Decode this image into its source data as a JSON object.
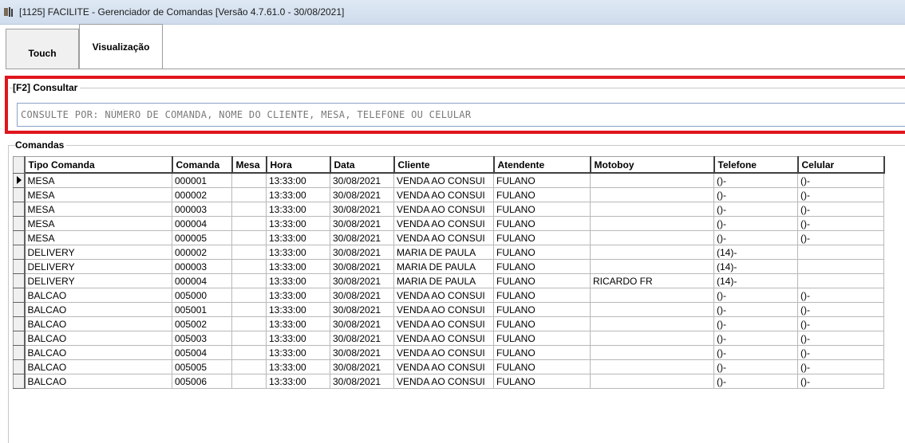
{
  "window": {
    "title": "[1125] FACILITE - Gerenciador de Comandas [Versão 4.7.61.0 - 30/08/2021]"
  },
  "tabs": [
    {
      "label": "Touch"
    },
    {
      "label": "Visualização"
    }
  ],
  "consult": {
    "legend": "[F2] Consultar",
    "placeholder": "CONSULTE POR: NÚMERO DE COMANDA, NOME DO CLIENTE, MESA, TELEFONE OU CELULAR"
  },
  "grid": {
    "legend": "Comandas",
    "columns": [
      "Tipo Comanda",
      "Comanda",
      "Mesa",
      "Hora",
      "Data",
      "Cliente",
      "Atendente",
      "Motoboy",
      "Telefone",
      "Celular"
    ],
    "rows": [
      [
        "MESA",
        "000001",
        "",
        "13:33:00",
        "30/08/2021",
        "VENDA AO CONSUI",
        "FULANO",
        "",
        "()-",
        "()-"
      ],
      [
        "MESA",
        "000002",
        "",
        "13:33:00",
        "30/08/2021",
        "VENDA AO CONSUI",
        "FULANO",
        "",
        "()-",
        "()-"
      ],
      [
        "MESA",
        "000003",
        "",
        "13:33:00",
        "30/08/2021",
        "VENDA AO CONSUI",
        "FULANO",
        "",
        "()-",
        "()-"
      ],
      [
        "MESA",
        "000004",
        "",
        "13:33:00",
        "30/08/2021",
        "VENDA AO CONSUI",
        "FULANO",
        "",
        "()-",
        "()-"
      ],
      [
        "MESA",
        "000005",
        "",
        "13:33:00",
        "30/08/2021",
        "VENDA AO CONSUI",
        "FULANO",
        "",
        "()-",
        "()-"
      ],
      [
        "DELIVERY",
        "000002",
        "",
        "13:33:00",
        "30/08/2021",
        "MARIA DE PAULA",
        "FULANO",
        "",
        "(14)-",
        ""
      ],
      [
        "DELIVERY",
        "000003",
        "",
        "13:33:00",
        "30/08/2021",
        "MARIA DE PAULA",
        "FULANO",
        "",
        "(14)-",
        ""
      ],
      [
        "DELIVERY",
        "000004",
        "",
        "13:33:00",
        "30/08/2021",
        "MARIA DE PAULA",
        "FULANO",
        "RICARDO FR",
        "(14)-",
        ""
      ],
      [
        "BALCAO",
        "005000",
        "",
        "13:33:00",
        "30/08/2021",
        "VENDA AO CONSUI",
        "FULANO",
        "",
        "()-",
        "()-"
      ],
      [
        "BALCAO",
        "005001",
        "",
        "13:33:00",
        "30/08/2021",
        "VENDA AO CONSUI",
        "FULANO",
        "",
        "()-",
        "()-"
      ],
      [
        "BALCAO",
        "005002",
        "",
        "13:33:00",
        "30/08/2021",
        "VENDA AO CONSUI",
        "FULANO",
        "",
        "()-",
        "()-"
      ],
      [
        "BALCAO",
        "005003",
        "",
        "13:33:00",
        "30/08/2021",
        "VENDA AO CONSUI",
        "FULANO",
        "",
        "()-",
        "()-"
      ],
      [
        "BALCAO",
        "005004",
        "",
        "13:33:00",
        "30/08/2021",
        "VENDA AO CONSUI",
        "FULANO",
        "",
        "()-",
        "()-"
      ],
      [
        "BALCAO",
        "005005",
        "",
        "13:33:00",
        "30/08/2021",
        "VENDA AO CONSUI",
        "FULANO",
        "",
        "()-",
        "()-"
      ],
      [
        "BALCAO",
        "005006",
        "",
        "13:33:00",
        "30/08/2021",
        "VENDA AO CONSUI",
        "FULANO",
        "",
        "()-",
        "()-"
      ]
    ]
  },
  "colors": {
    "highlight_border": "#e0151d"
  }
}
